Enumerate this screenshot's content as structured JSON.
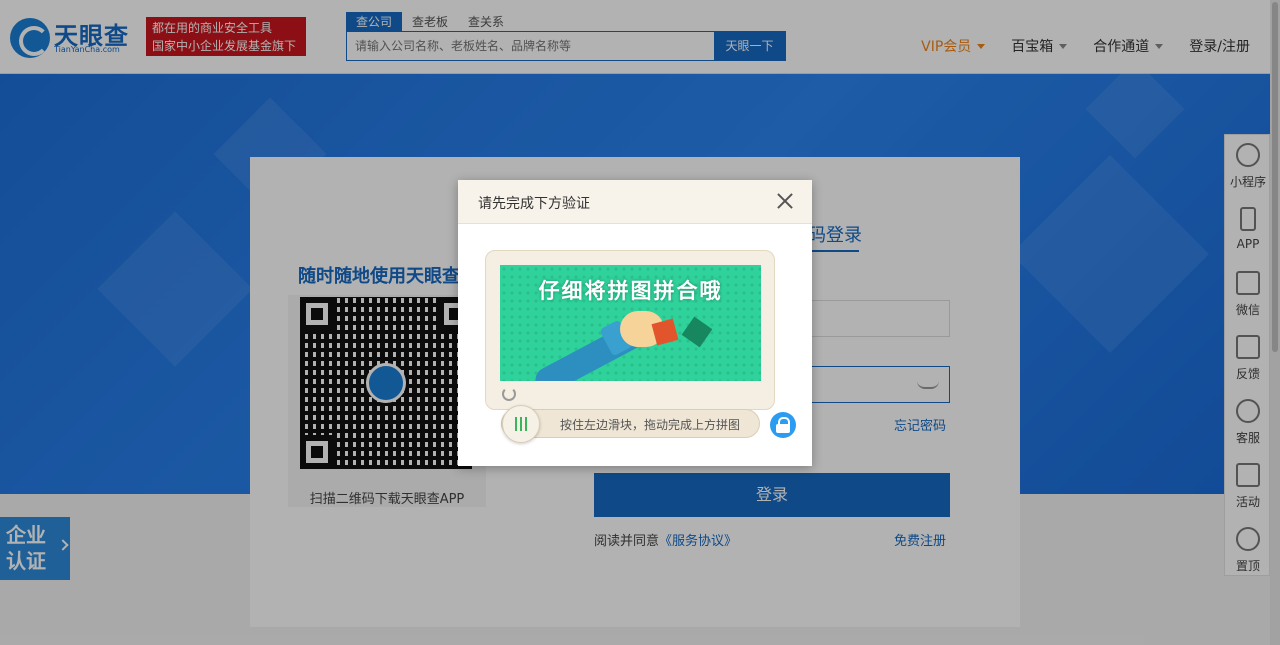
{
  "header": {
    "logo_name": "天眼查",
    "logo_sub": "TianYanCha.com",
    "slogan_line1": "都在用的商业安全工具",
    "slogan_line2": "国家中小企业发展基金旗下",
    "search_tabs": [
      "查公司",
      "查老板",
      "查关系"
    ],
    "search_placeholder": "请输入公司名称、老板姓名、品牌名称等",
    "search_button": "天眼一下",
    "nav": [
      "VIP会员",
      "百宝箱",
      "合作通道",
      "登录/注册"
    ]
  },
  "login": {
    "qr_title": "随时随地使用天眼查",
    "qr_caption": "扫描二维码下载天眼查APP",
    "tab_label": "码登录",
    "forgot": "忘记密码",
    "login_button": "登录",
    "agree_prefix": "阅读并同意",
    "agree_link": "《服务协议》",
    "register": "免费注册"
  },
  "enterprise_badge": [
    "企业",
    "认证"
  ],
  "sidebar": [
    "小程序",
    "APP",
    "微信",
    "反馈",
    "客服",
    "活动",
    "置顶"
  ],
  "modal": {
    "title": "请先完成下方验证",
    "puzzle_text": "仔细将拼图拼合哦",
    "slider_text": "按住左边滑块，拖动完成上方拼图"
  },
  "colors": {
    "brand": "#1669c2",
    "vip": "#f08519",
    "slogan_bg": "#c8161d",
    "puzzle_bg": "#2fd29b"
  }
}
